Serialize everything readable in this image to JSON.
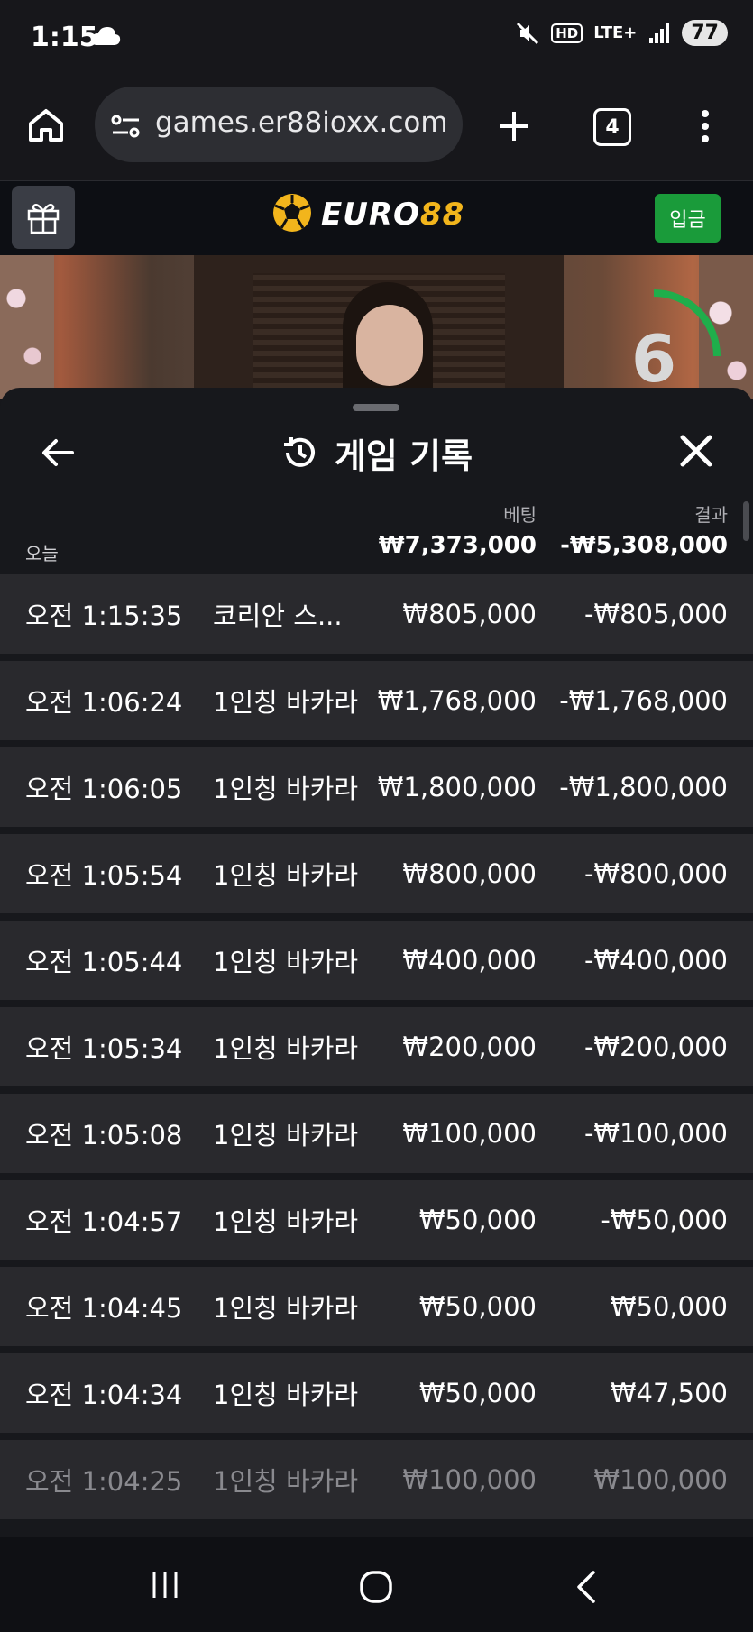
{
  "status": {
    "time": "1:15",
    "network": "LTE+",
    "hd": "HD",
    "battery": "77"
  },
  "browser": {
    "url": "games.er88ioxx.com",
    "tab_count": "4"
  },
  "site": {
    "logo_main": "EURO",
    "logo_accent": "88",
    "deposit_label": "입금"
  },
  "game": {
    "countdown": "6"
  },
  "sheet": {
    "title": "게임 기록",
    "bet_header": "베팅",
    "result_header": "결과",
    "date_label": "오늘",
    "total_bet": "₩7,373,000",
    "total_result": "-₩5,308,000",
    "rows": [
      {
        "time": "오전 1:15:35",
        "game": "코리안 스...",
        "bet": "₩805,000",
        "result": "-₩805,000"
      },
      {
        "time": "오전 1:06:24",
        "game": "1인칭 바카라",
        "bet": "₩1,768,000",
        "result": "-₩1,768,000"
      },
      {
        "time": "오전 1:06:05",
        "game": "1인칭 바카라",
        "bet": "₩1,800,000",
        "result": "-₩1,800,000"
      },
      {
        "time": "오전 1:05:54",
        "game": "1인칭 바카라",
        "bet": "₩800,000",
        "result": "-₩800,000"
      },
      {
        "time": "오전 1:05:44",
        "game": "1인칭 바카라",
        "bet": "₩400,000",
        "result": "-₩400,000"
      },
      {
        "time": "오전 1:05:34",
        "game": "1인칭 바카라",
        "bet": "₩200,000",
        "result": "-₩200,000"
      },
      {
        "time": "오전 1:05:08",
        "game": "1인칭 바카라",
        "bet": "₩100,000",
        "result": "-₩100,000"
      },
      {
        "time": "오전 1:04:57",
        "game": "1인칭 바카라",
        "bet": "₩50,000",
        "result": "-₩50,000"
      },
      {
        "time": "오전 1:04:45",
        "game": "1인칭 바카라",
        "bet": "₩50,000",
        "result": "₩50,000"
      },
      {
        "time": "오전 1:04:34",
        "game": "1인칭 바카라",
        "bet": "₩50,000",
        "result": "₩47,500"
      },
      {
        "time": "오전 1:04:25",
        "game": "1인칭 바카라",
        "bet": "₩100,000",
        "result": "₩100,000"
      }
    ]
  },
  "colors": {
    "brand_gold": "#f2b51c",
    "deposit_green": "#1a9b3a",
    "timer_green": "#1fae4b"
  }
}
